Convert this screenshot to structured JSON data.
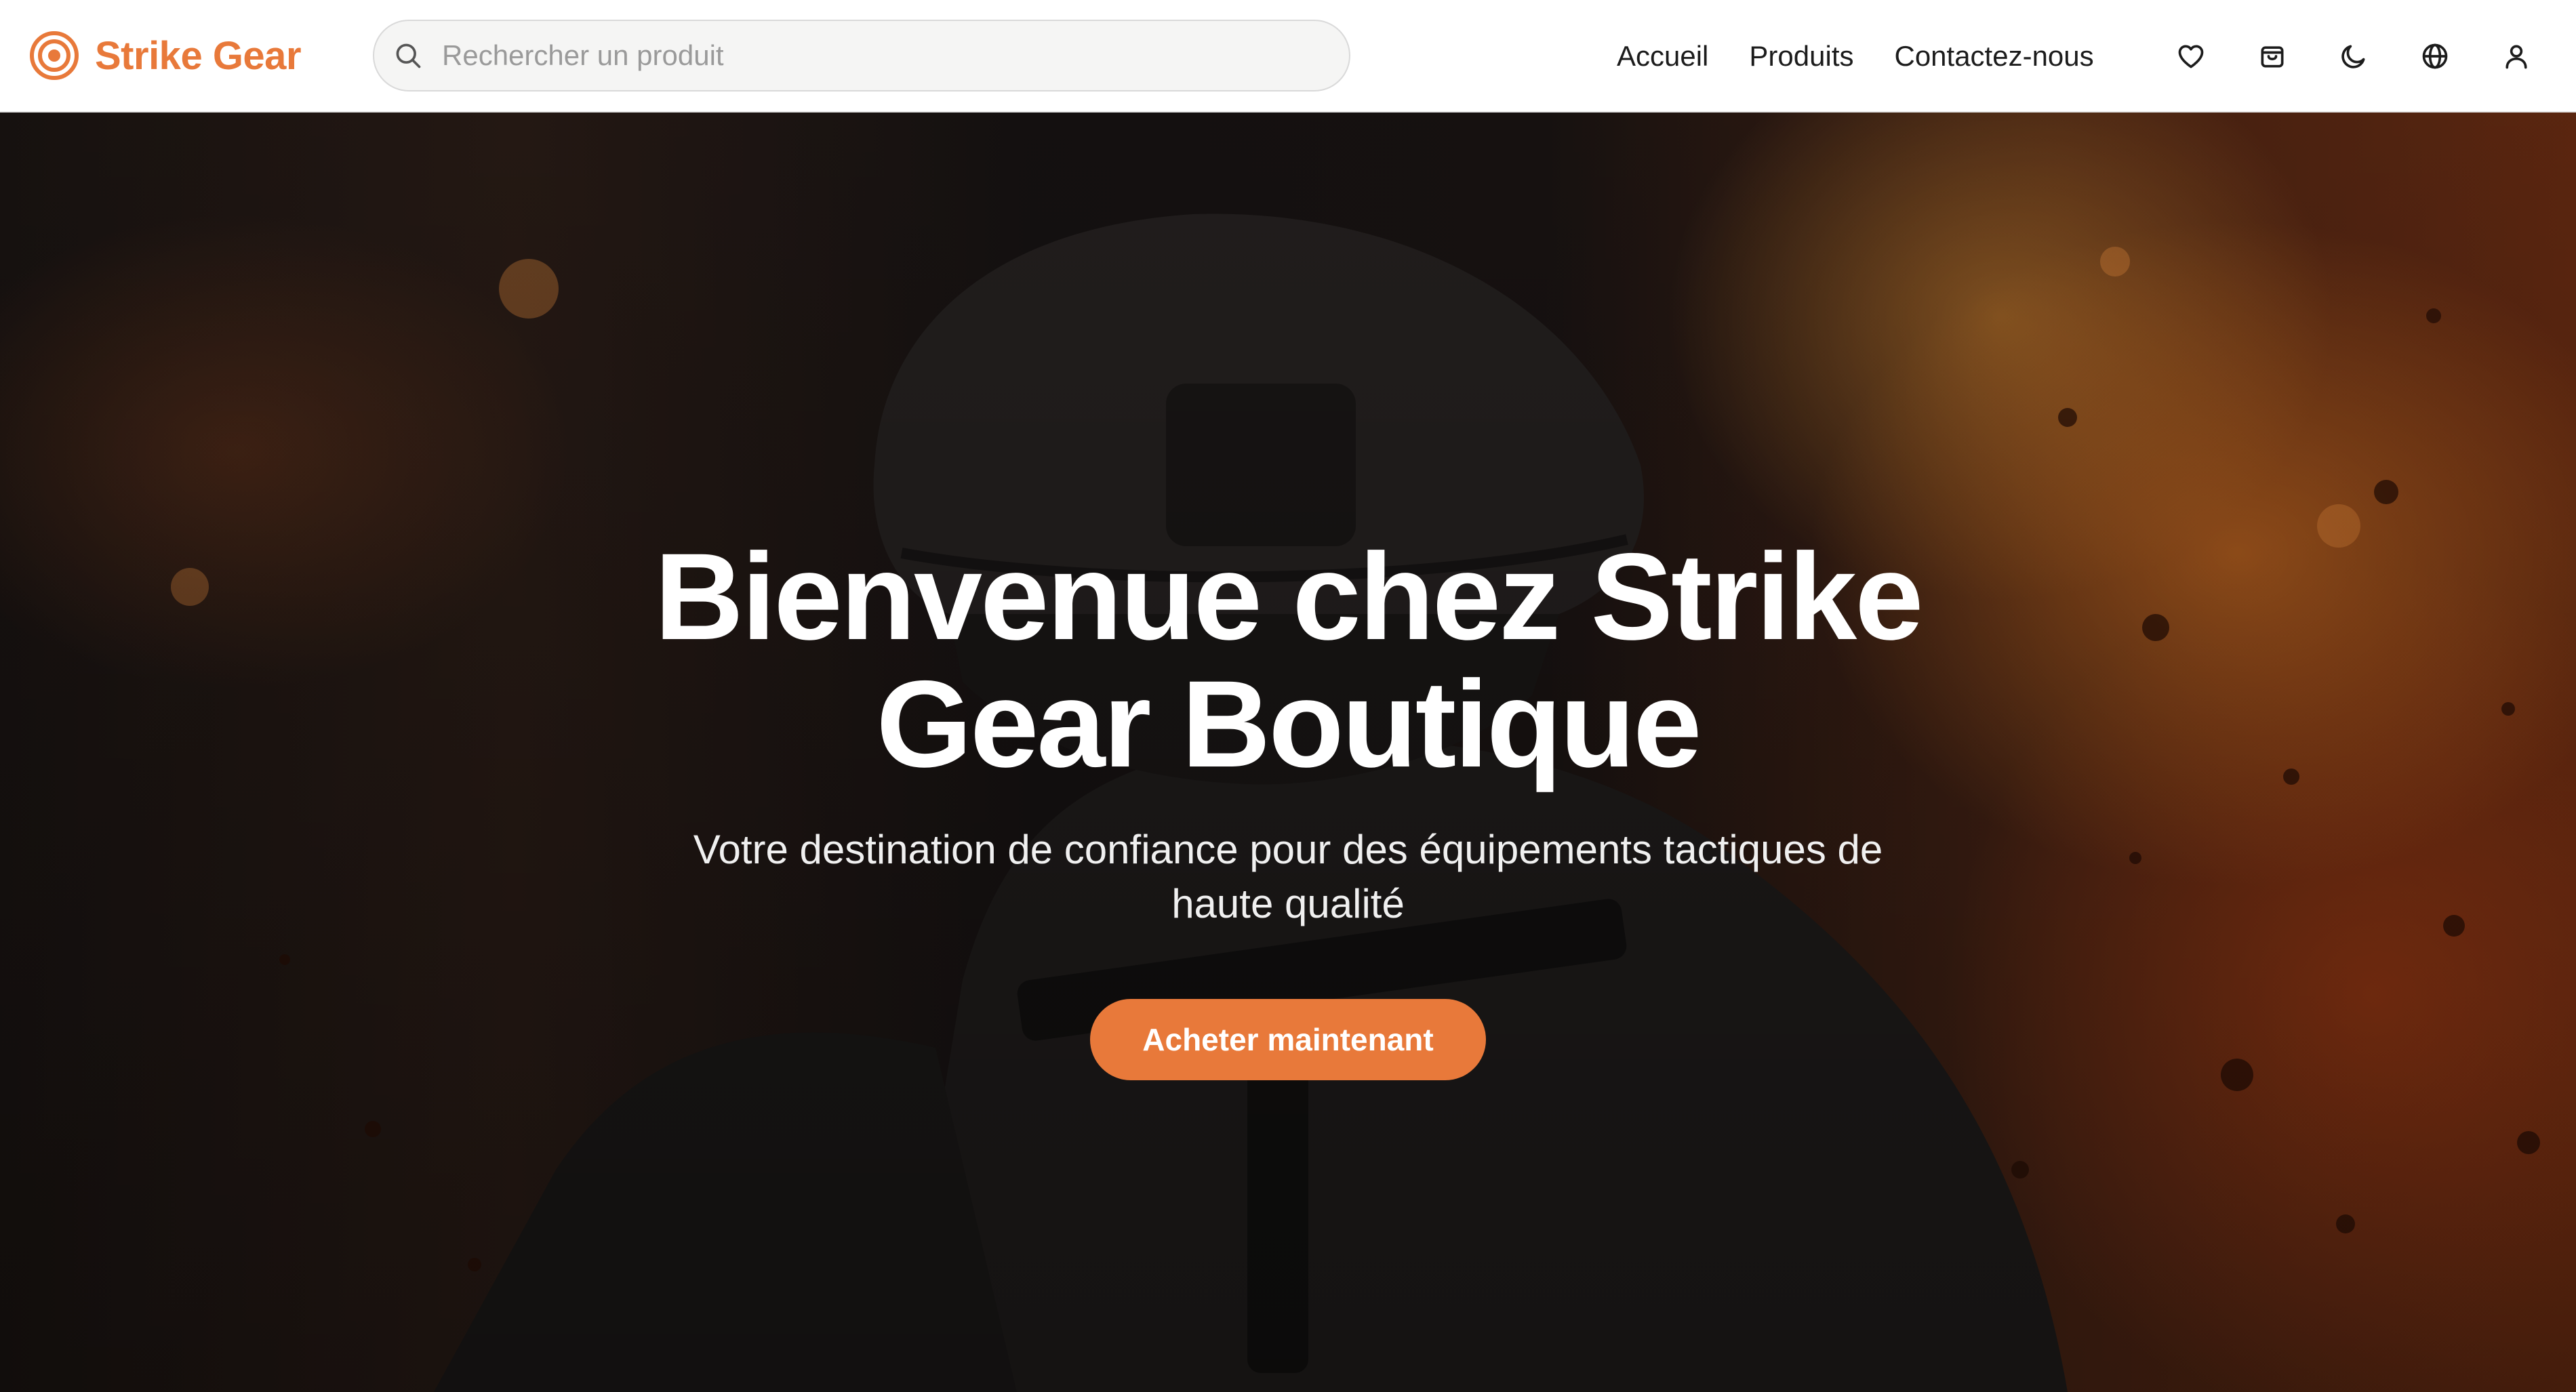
{
  "brand": {
    "name": "Strike Gear",
    "color": "#e8793a"
  },
  "search": {
    "placeholder": "Rechercher un produit"
  },
  "nav": {
    "items": [
      {
        "label": "Accueil"
      },
      {
        "label": "Produits"
      },
      {
        "label": "Contactez-nous"
      }
    ]
  },
  "header_icons": [
    "heart-icon",
    "shopping-bag-icon",
    "moon-icon",
    "globe-icon",
    "user-icon"
  ],
  "hero": {
    "title_line1": "Bienvenue chez Strike",
    "title_line2": "Gear Boutique",
    "subtitle_line1": "Votre destination de confiance pour des équipements tactiques de",
    "subtitle_line2": "haute qualité",
    "cta_label": "Acheter maintenant",
    "background_image": "soldier-in-helmet-with-fire-background"
  }
}
